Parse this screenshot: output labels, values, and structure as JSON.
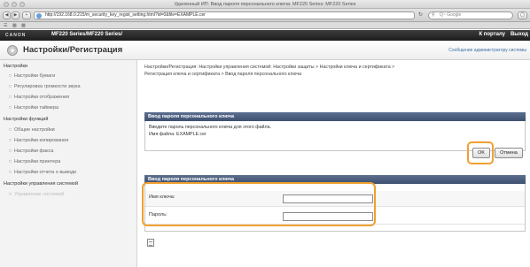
{
  "window": {
    "title": "Удаленный ИП: Ввод пароля персонального ключа: MF220 Series: MF220 Series"
  },
  "browser": {
    "url": "http://192.168.0.215/m_security_key_regist_setting.html?id=0&file=EXAMPLE.cer",
    "search_placeholder": "Q~ Google",
    "icons": {
      "back": "back-arrow-icon",
      "forward": "forward-arrow-icon",
      "add": "add-tab-icon",
      "reload": "reload-icon",
      "search": "search-icon",
      "bookmarks": "bookmarks-icon",
      "grid": "grid-icon"
    }
  },
  "device_header": {
    "brand": "CANON",
    "device": "MF220 Series/MF220 Series/",
    "portal_link": "К порталу",
    "logout_link": "Выход"
  },
  "page": {
    "title": "Настройки/Регистрация",
    "admin_message": "Сообщение администратору системы"
  },
  "sidebar": {
    "sections": [
      {
        "heading": "Настройки",
        "items": [
          "Настройки бумаги",
          "Регулировка громкости звука",
          "Настройки отображения",
          "Настройки таймера"
        ]
      },
      {
        "heading": "Настройки функций",
        "items": [
          "Общие настройки",
          "Настройки копирования",
          "Настройки факса",
          "Настройки принтера",
          "Настройки отчета о выводе"
        ]
      },
      {
        "heading": "Настройки управления системой",
        "items": [
          "Управление системой"
        ]
      }
    ]
  },
  "main": {
    "breadcrumb_line1": "Настройки/Регистрация: Настройки управления системой: Настройки защиты > Настройки ключа и сертификата >",
    "breadcrumb_line2": "Регистрация ключа и сертификата > Ввод пароля персонального ключа",
    "box1_title": "Ввод пароля персонального ключа",
    "box1_msg1": "Введите пароль персонального ключа для этого файла.",
    "box1_msg2": "Имя файла: EXAMPLE.cer",
    "ok_label": "OK",
    "cancel_label": "Отмена",
    "box2_title": "Ввод пароля персонального ключа",
    "key_name_label": "Имя ключа:",
    "password_label": "Пароль:",
    "key_name_value": "",
    "password_value": ""
  },
  "colors": {
    "highlight": "#f0a030",
    "box_header": "#4a5d7e"
  }
}
